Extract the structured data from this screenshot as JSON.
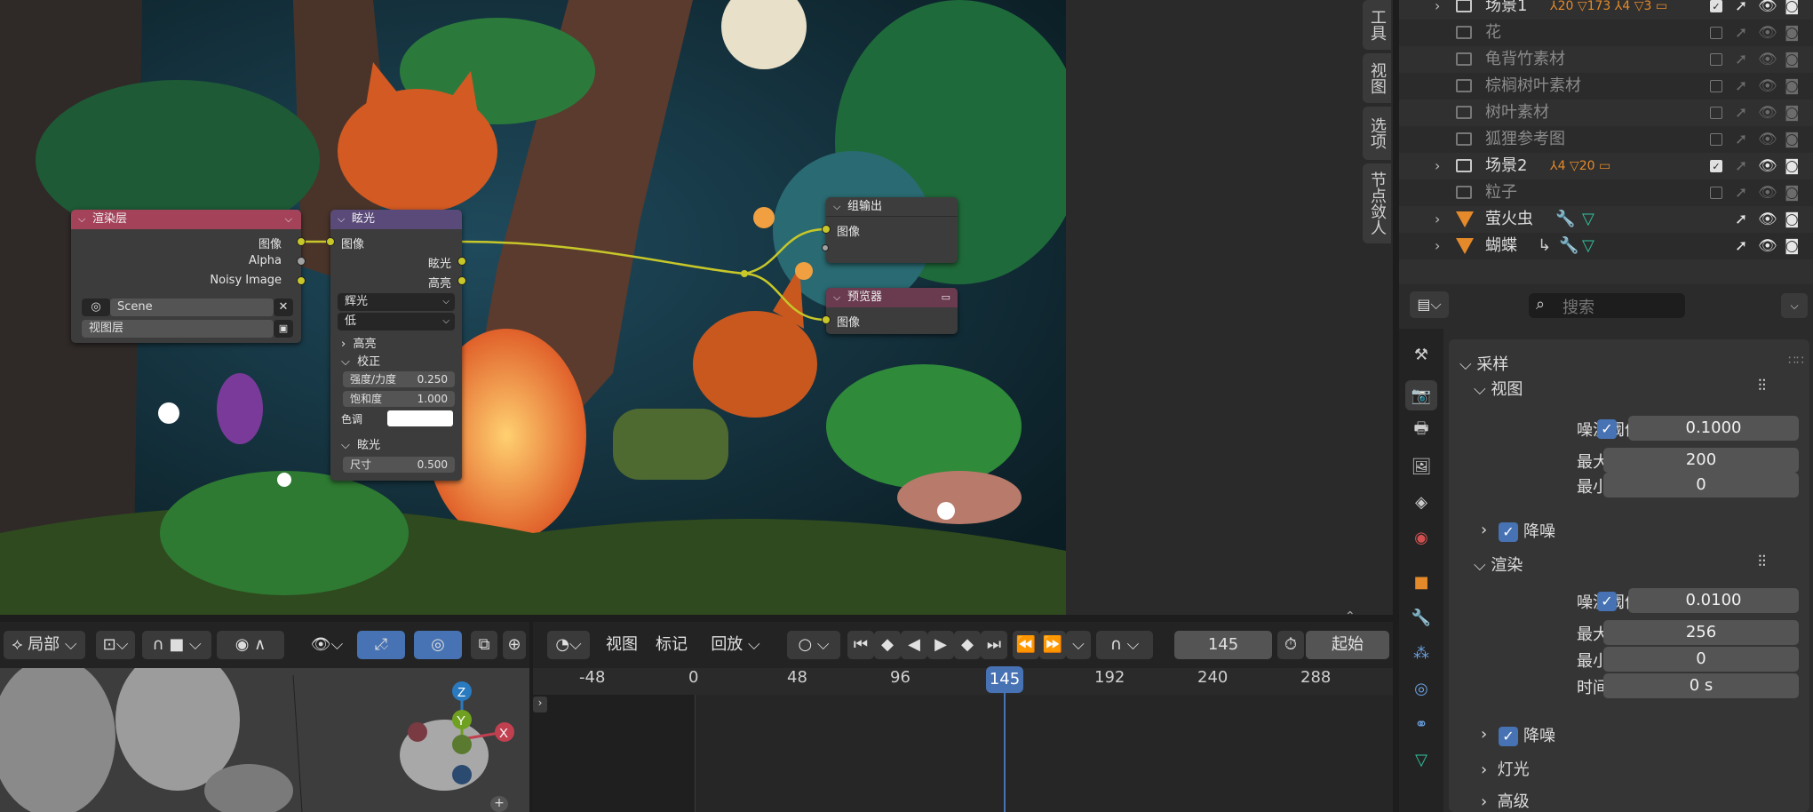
{
  "compositor": {
    "side_tabs": [
      "工具",
      "视图",
      "选项",
      "节点敛人"
    ],
    "nodes": {
      "render_layers": {
        "title": "渲染层",
        "outputs": [
          "图像",
          "Alpha",
          "Noisy Image"
        ],
        "scene": "Scene",
        "view_layer": "视图层"
      },
      "glare": {
        "title": "眩光",
        "input": "图像",
        "outputs": [
          "眩光",
          "高亮"
        ],
        "type": "辉光",
        "quality": "低",
        "section_highlight": "高亮",
        "section_adjust": "校正",
        "strength_label": "强度/力度",
        "strength_value": "0.250",
        "saturation_label": "饱和度",
        "saturation_value": "1.000",
        "tint_label": "色调",
        "section_glare": "眩光",
        "size_label": "尺寸",
        "size_value": "0.500"
      },
      "composite": {
        "title": "组输出",
        "input": "图像"
      },
      "viewer": {
        "title": "预览器",
        "input": "图像"
      }
    }
  },
  "outliner": {
    "rows": [
      {
        "label": "场景1",
        "type": "collection",
        "dim": false
      },
      {
        "label": "花",
        "type": "collection",
        "dim": true
      },
      {
        "label": "龟背竹素材",
        "type": "collection",
        "dim": true
      },
      {
        "label": "棕榈树叶素材",
        "type": "collection",
        "dim": true
      },
      {
        "label": "树叶素材",
        "type": "collection",
        "dim": true
      },
      {
        "label": "狐狸参考图",
        "type": "collection",
        "dim": true
      },
      {
        "label": "场景2",
        "type": "collection",
        "dim": false
      },
      {
        "label": "粒子",
        "type": "collection",
        "dim": true
      },
      {
        "label": "萤火虫",
        "type": "object",
        "dim": false
      },
      {
        "label": "蝴蝶",
        "type": "object",
        "dim": false
      }
    ],
    "badges": {
      "scene1_a": "20",
      "scene1_b": "173",
      "scene1_c": "4",
      "scene1_d": "3",
      "scene2_a": "4",
      "scene2_b": "20"
    }
  },
  "properties": {
    "search_placeholder": "搜索",
    "sampling": "采样",
    "viewport": "视图",
    "noise_threshold": "噪波阈值",
    "viewport_noise_value": "0.1000",
    "max_samples": "最大采样",
    "viewport_max_value": "200",
    "min_samples": "最小采样",
    "viewport_min_value": "0",
    "denoise": "降噪",
    "render": "渲染",
    "render_noise_value": "0.0100",
    "render_max_value": "256",
    "render_min_value": "0",
    "time_limit": "时间限制",
    "time_limit_value": "0 s",
    "light_paths": "灯光",
    "advanced": "高级"
  },
  "timeline": {
    "view": "视图",
    "marker": "标记",
    "playback": "回放",
    "current_frame": "145",
    "start_label": "起始",
    "ruler": [
      "-48",
      "0",
      "48",
      "96",
      "145",
      "192",
      "240",
      "288"
    ]
  },
  "viewport3d": {
    "mode": "局部",
    "axes": {
      "z": "Z",
      "y": "Y",
      "x": "X"
    }
  },
  "colors": {
    "accent": "#4772b3",
    "socket_yellow": "#c7c729",
    "render_layer_header": "#a4425a",
    "glare_header": "#5a4a7a",
    "output_header": "#3d3d3d",
    "viewer_header": "#6a3a4e",
    "collection_orange": "#e48a2a"
  }
}
